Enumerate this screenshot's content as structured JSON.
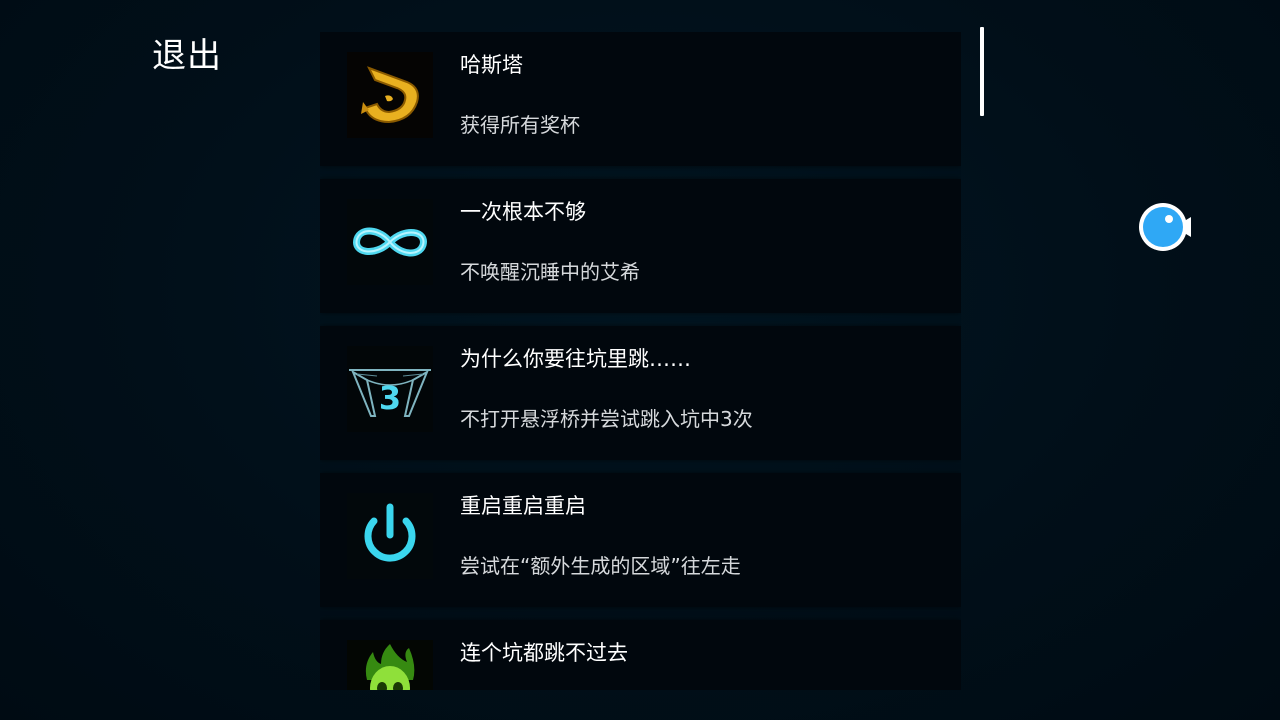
{
  "header": {
    "exit_label": "退出"
  },
  "achievements": [
    {
      "title": "哈斯塔",
      "description": "获得所有奖杯",
      "icon": "golden-sigil-icon"
    },
    {
      "title": "一次根本不够",
      "description": "不唤醒沉睡中的艾希",
      "icon": "infinity-icon"
    },
    {
      "title": "为什么你要往坑里跳……",
      "description": "不打开悬浮桥并尝试跳入坑中3次",
      "icon": "pit-three-icon",
      "badge_number": "3"
    },
    {
      "title": "重启重启重启",
      "description": "尝试在“额外生成的区域”往左走",
      "icon": "power-icon"
    },
    {
      "title": "连个坑都跳不过去",
      "description": "",
      "icon": "green-skull-icon"
    }
  ],
  "colors": {
    "background": "#010f19",
    "card": "#01070d",
    "accent_cyan": "#3ad6ee",
    "accent_gold": "#e8b020",
    "float_button": "#2fa8f5"
  }
}
